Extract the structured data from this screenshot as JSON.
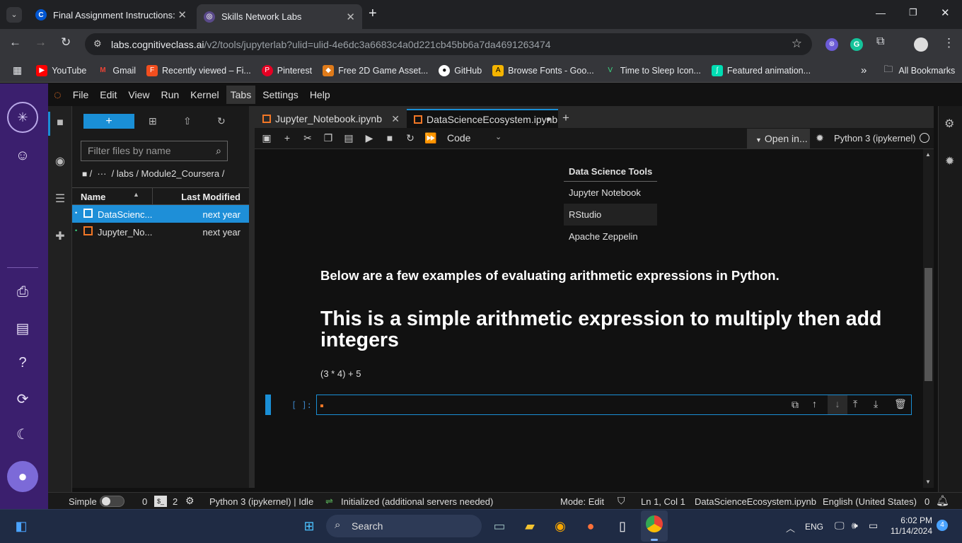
{
  "browser": {
    "tabs": [
      {
        "title": "Final Assignment Instructions: C",
        "icon": "coursera-icon",
        "active": false
      },
      {
        "title": "Skills Network Labs",
        "icon": "skills-network-icon",
        "active": true
      }
    ],
    "new_tab": "+",
    "url_host": "labs.cognitiveclass.ai",
    "url_path": "/v2/tools/jupyterlab?ulid=ulid-4e6dc3a6683c4a0d221cb45bb6a7da4691263474",
    "bookmarks": [
      {
        "label": "YouTube",
        "icon": "youtube-icon",
        "color": "#ff0000"
      },
      {
        "label": "Gmail",
        "icon": "gmail-icon",
        "color": "#ea4335"
      },
      {
        "label": "Recently viewed – Fi...",
        "icon": "figma-icon",
        "color": "#f24e1e"
      },
      {
        "label": "Pinterest",
        "icon": "pinterest-icon",
        "color": "#e60023"
      },
      {
        "label": "Free 2D Game Asset...",
        "icon": "game-asset-icon",
        "color": "#e07b1a"
      },
      {
        "label": "GitHub",
        "icon": "github-icon",
        "color": "#ffffff"
      },
      {
        "label": "Browse Fonts - Goo...",
        "icon": "google-fonts-icon",
        "color": "#f4b400"
      },
      {
        "label": "Time to Sleep Icon...",
        "icon": "vector-icon",
        "color": "#3ddc84"
      },
      {
        "label": "Featured animation...",
        "icon": "lottie-icon",
        "color": "#00ddb3"
      }
    ],
    "bookmarks_overflow": "»",
    "all_bookmarks": "All Bookmarks"
  },
  "jupyter": {
    "menu": [
      "File",
      "Edit",
      "View",
      "Run",
      "Kernel",
      "Tabs",
      "Settings",
      "Help"
    ],
    "menu_highlight": "Tabs",
    "filebrowser": {
      "new_button": "+",
      "filter_placeholder": "Filter files by name",
      "breadcrumb": "/  ···  / labs / Module2_Coursera /",
      "col_name": "Name",
      "col_modified": "Last Modified",
      "sort_glyph": "▲",
      "files": [
        {
          "name": "DataScienc...",
          "modified": "next year",
          "selected": true
        },
        {
          "name": "Jupyter_No...",
          "modified": "next year",
          "selected": false
        }
      ]
    },
    "notebook_tabs": [
      {
        "title": "Jupyter_Notebook.ipynb",
        "active": false
      },
      {
        "title": "DataScienceEcosystem.ipynb",
        "active": true
      }
    ],
    "add_tab": "+",
    "cell_type": "Code",
    "open_in": "Open in...",
    "kernel": "Python 3 (ipykernel)",
    "table": {
      "header": "Data Science Tools",
      "rows": [
        "Jupyter Notebook",
        "RStudio",
        "Apache Zeppelin"
      ]
    },
    "intro_text": "Below are a few examples of evaluating arithmetic expressions in Python.",
    "heading": "This is a simple arithmetic expression to multiply then add integers",
    "expression": "(3 * 4) + 5",
    "prompt": "[ ]:",
    "status": {
      "mode_label": "Simple",
      "count1": "0",
      "count2": "2",
      "kernel_status": "Python 3 (ipykernel) | Idle",
      "lsp_status": "Initialized (additional servers needed)",
      "mode": "Mode: Edit",
      "cursor": "Ln 1, Col 1",
      "file": "DataScienceEcosystem.ipynb",
      "language": "English (United States)",
      "notifications": "0"
    }
  },
  "taskbar": {
    "search": "Search",
    "lang": "ENG",
    "time": "6:02 PM",
    "date": "11/14/2024",
    "badge": "4"
  }
}
